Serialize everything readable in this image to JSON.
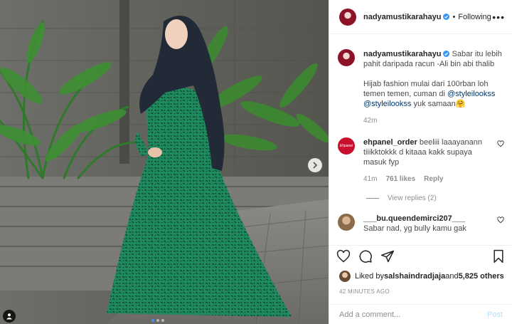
{
  "photo": {
    "alt": "Woman in a black hijab and green patterned dress posing by a wall with palm plants",
    "slide_count": 3,
    "active_slide": 1
  },
  "header": {
    "username": "nadyamustikarahayu",
    "separator": "•",
    "follow_label": "Following",
    "more": "•••"
  },
  "caption": {
    "username": "nadyamustikarahayu",
    "line1": "Sabar itu lebih pahit daripada racun -Ali bin abi thalib",
    "line2": "Hijab fashion mulai dari 100rban loh temen temen, cuman di ",
    "mention1": "@styleilookss",
    "mention2": "@styleilookss",
    "line2_end": " yuk samaan",
    "emoji": "🤗",
    "time": "42m"
  },
  "comments": [
    {
      "username": "ehpanel_order",
      "avatar_text": "Ehpanel",
      "text": "beeliii laaayanann tiiikktokkk d kitaaa kakk supaya masuk fyp",
      "time": "41m",
      "likes": "761 likes",
      "reply": "Reply",
      "view_replies": "View replies (2)"
    },
    {
      "username": "___bu.queendemirci207___",
      "text": "Sabar nad, yg bully kamu gak"
    }
  ],
  "likes": {
    "prefix": "Liked by ",
    "user": "salshaindradjaja",
    "conj": " and ",
    "others": "5,825 others"
  },
  "posted": "42 MINUTES AGO",
  "add_comment": {
    "placeholder": "Add a comment...",
    "post_label": "Post"
  },
  "icons": {
    "like": "heart-icon",
    "comment": "comment-icon",
    "share": "share-icon",
    "save": "bookmark-icon",
    "next": "chevron-right-icon",
    "tag": "user-tag-icon"
  },
  "colors": {
    "verified": "#3897f0",
    "link": "#00376b",
    "muted": "#8e8e8e",
    "post_disabled": "#b2dffc"
  }
}
